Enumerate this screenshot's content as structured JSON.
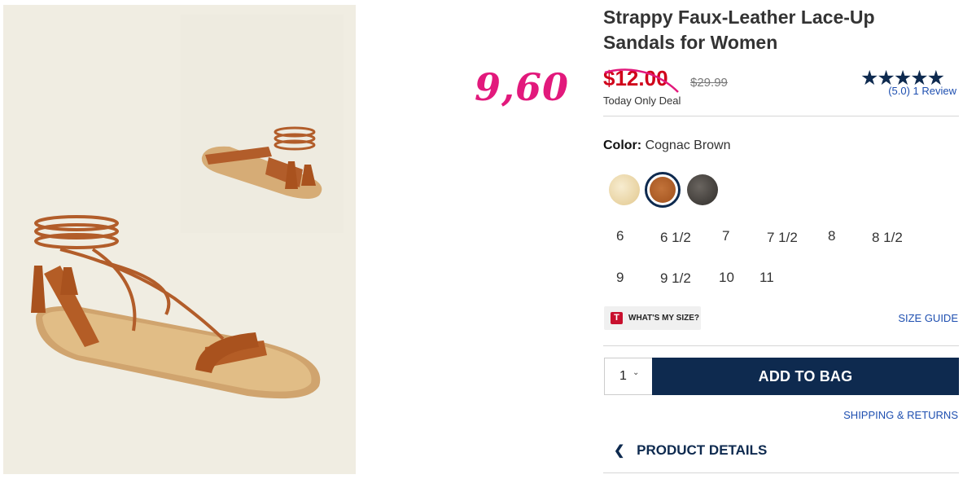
{
  "annotation": {
    "handwritten_price": "9,60",
    "color": "#e2197c"
  },
  "product": {
    "title": "Strappy Faux-Leather Lace-Up Sandals for Women",
    "sale_price": "$12.00",
    "original_price": "$29.99",
    "deal_label": "Today Only Deal"
  },
  "rating": {
    "stars": "★★★★★",
    "value": 5.0,
    "reviews_text": "(5.0) 1 Review"
  },
  "color": {
    "label": "Color:",
    "selected": "Cognac Brown",
    "swatches": [
      {
        "name": "gold",
        "color": "#e8d2a0"
      },
      {
        "name": "cognac-brown",
        "color": "#b8642a"
      },
      {
        "name": "black",
        "color": "#3a3835"
      }
    ]
  },
  "sizes": [
    "6",
    "6 1/2",
    "7",
    "7 1/2",
    "8",
    "8 1/2",
    "9",
    "9 1/2",
    "10",
    "11"
  ],
  "size_tools": {
    "whats_my_size_badge": "T",
    "whats_my_size": "WHAT'S MY SIZE?",
    "size_guide": "SIZE GUIDE"
  },
  "purchase": {
    "quantity": "1",
    "add_to_bag": "ADD TO BAG",
    "shipping_returns": "SHIPPING & RETURNS"
  },
  "sections": {
    "product_details": "PRODUCT DETAILS"
  },
  "icons": {
    "chevron_down": "chevron-down-icon",
    "chevron_left": "chevron-left-icon"
  },
  "colors": {
    "navy": "#0e2a4f",
    "sale_red": "#d0021b",
    "link_blue": "#1e4fb0"
  }
}
